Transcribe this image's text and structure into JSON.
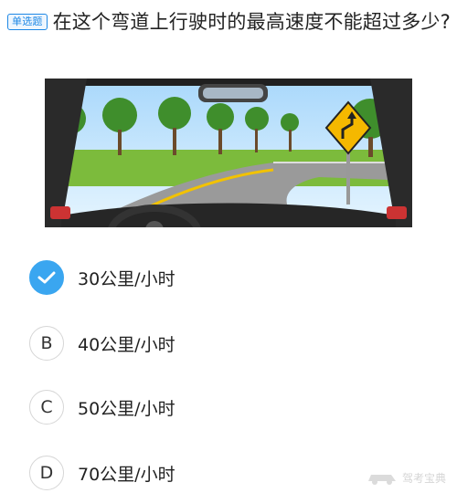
{
  "question": {
    "type_tag": "单选题",
    "text": "在这个弯道上行驶时的最高速度不能超过多少?"
  },
  "options": [
    {
      "letter": "",
      "text": "30公里/小时",
      "selected": true
    },
    {
      "letter": "B",
      "text": "40公里/小时",
      "selected": false
    },
    {
      "letter": "C",
      "text": "50公里/小时",
      "selected": false
    },
    {
      "letter": "D",
      "text": "70公里/小时",
      "selected": false
    }
  ],
  "icons": {
    "selected": "check-icon",
    "sign": "winding-road-sign-icon"
  },
  "watermark": "驾考宝典",
  "colors": {
    "accent": "#3aa6f0",
    "tag": "#1e88e5",
    "sign_yellow": "#f5b800"
  }
}
